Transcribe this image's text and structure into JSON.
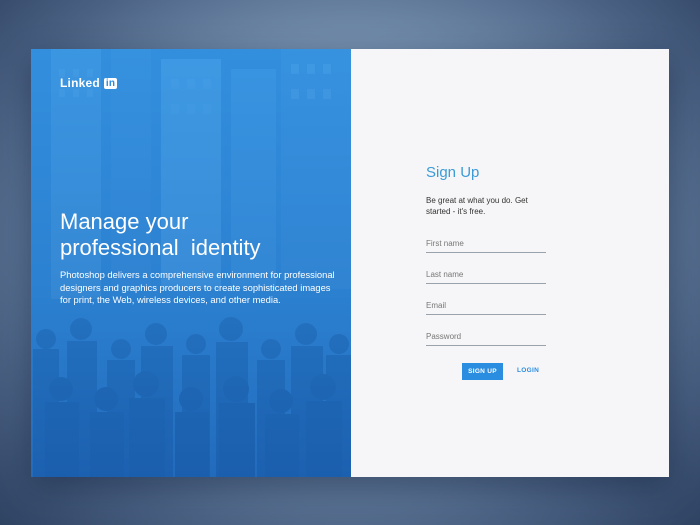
{
  "brand": {
    "name": "Linked",
    "badge": "in"
  },
  "hero": {
    "headline_line1": "Manage your",
    "headline_line2": "professional  identity",
    "description": "Photoshop delivers a comprehensive environment for professional designers and graphics producers to create sophisticated images for print, the Web, wireless devices, and other media."
  },
  "form": {
    "title": "Sign Up",
    "tagline": "Be great at what you do. Get started - it's free.",
    "first_name_placeholder": "First name",
    "last_name_placeholder": "Last name",
    "email_placeholder": "Email",
    "password_placeholder": "Password",
    "signup_label": "SIGN UP",
    "login_label": "LOGIN"
  },
  "colors": {
    "accent": "#2a8de0",
    "title": "#3a9bd6",
    "panel": "#f6f6f8"
  }
}
